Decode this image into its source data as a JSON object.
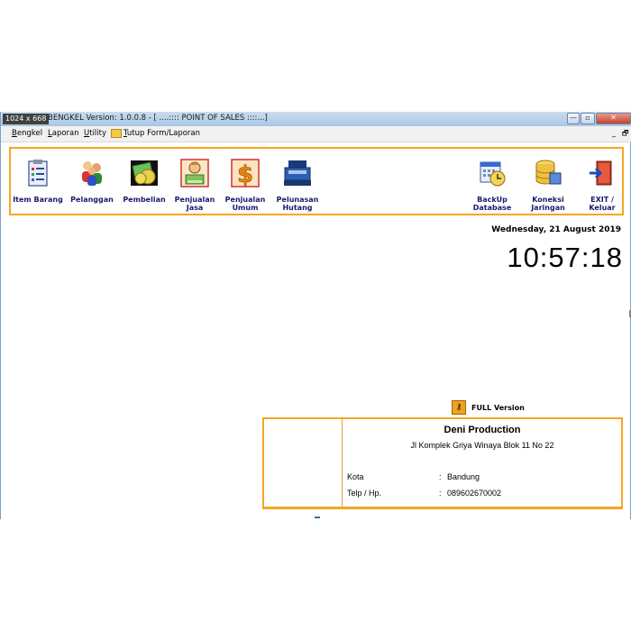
{
  "window": {
    "resolution_badge": "1024 x 668",
    "title": "BENGKEL    Version: 1.0.0.8 - [      ....:::: POINT OF SALES ::::...]",
    "min_glyph": "—",
    "max_glyph": "▫",
    "close_glyph": "✕"
  },
  "menu": {
    "bengkel": {
      "first": "B",
      "rest": "engkel"
    },
    "laporan": {
      "first": "L",
      "rest": "aporan"
    },
    "utility": {
      "first": "U",
      "rest": "tility"
    },
    "tutup": {
      "first": "T",
      "rest": "utup Form/Laporan"
    },
    "mdi_min": "_",
    "mdi_restore": "🗗"
  },
  "toolbar": [
    {
      "label": "Item Barang",
      "icon": "checklist-icon"
    },
    {
      "label": "Pelanggan",
      "icon": "customers-icon"
    },
    {
      "label": "Pembelian",
      "icon": "money-icon"
    },
    {
      "label": "Penjualan\nJasa",
      "icon": "cashier-icon"
    },
    {
      "label": "Penjualan\nUmum",
      "icon": "dollar-icon"
    },
    {
      "label": "Pelunasan\nHutang",
      "icon": "cash-register-icon"
    },
    {
      "label": "BackUp\nDatabase",
      "icon": "calendar-clock-icon"
    },
    {
      "label": "Koneksi\nJaringan",
      "icon": "database-icon"
    },
    {
      "label": "EXIT /\nKeluar",
      "icon": "exit-door-icon"
    }
  ],
  "datetime": {
    "date": "Wednesday, 21 August 2019",
    "time": "10:57:18"
  },
  "license": {
    "label": "FULL Version"
  },
  "company": {
    "name": "Deni Production",
    "address": "Jl Komplek Griya Winaya Blok 11 No 22",
    "city_label": "Kota",
    "city_value": "Bandung",
    "phone_label": "Telp / Hp.",
    "phone_value": "089602670002",
    "separator": ":"
  },
  "colors": {
    "accent_orange": "#f5a623",
    "title_blue": "#1a1a6e"
  }
}
